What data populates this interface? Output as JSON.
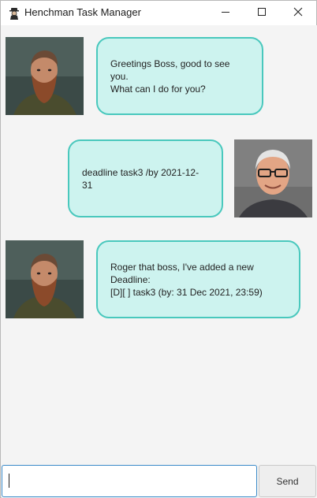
{
  "window": {
    "title": "Henchman Task Manager",
    "icon": "henchman-icon",
    "controls": [
      "minimize-icon",
      "maximize-icon",
      "close-icon"
    ]
  },
  "messages": [
    {
      "sender": "henchman",
      "text": "Greetings Boss, good to see you.\nWhat can I do for you?"
    },
    {
      "sender": "user",
      "text": "deadline task3 /by 2021-12-31"
    },
    {
      "sender": "henchman",
      "text": "Roger that boss, I've added a new\nDeadline:\n[D][ ] task3 (by: 31 Dec 2021, 23:59)"
    }
  ],
  "input": {
    "value": "",
    "placeholder": ""
  },
  "send_button": {
    "label": "Send"
  },
  "colors": {
    "bubble_fill": "#cdf3ef",
    "bubble_border": "#49c8bd",
    "input_focus_border": "#3a8ac8",
    "background": "#f4f4f4"
  }
}
